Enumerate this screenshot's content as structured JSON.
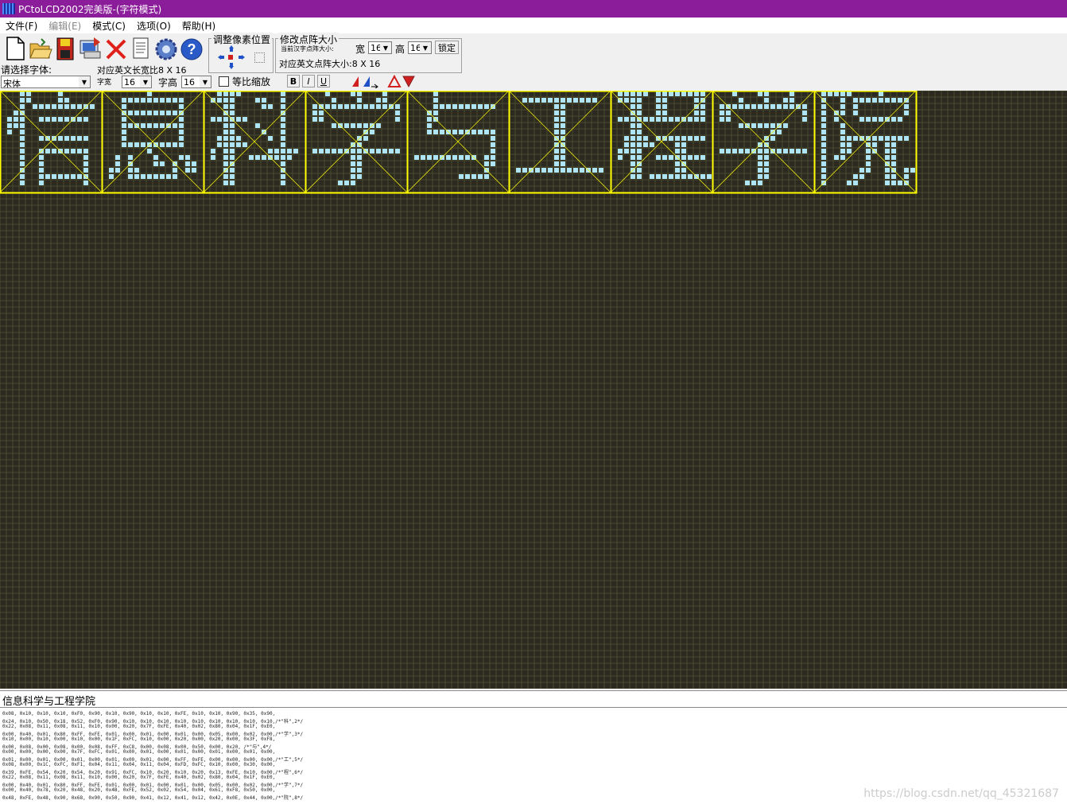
{
  "window": {
    "title": "PCtoLCD2002完美版-(字符模式)"
  },
  "menu": {
    "items": [
      {
        "label": "文件(F)",
        "enabled": true
      },
      {
        "label": "编辑(E)",
        "enabled": false
      },
      {
        "label": "模式(C)",
        "enabled": true
      },
      {
        "label": "选项(O)",
        "enabled": true
      },
      {
        "label": "帮助(H)",
        "enabled": true
      }
    ]
  },
  "toolbar": {
    "icons": [
      "new-file-icon",
      "open-folder-icon",
      "save-disk-icon",
      "generate-code-icon",
      "delete-x-icon",
      "document-icon",
      "settings-gear-icon",
      "help-icon"
    ],
    "font_label": "请选择字体:",
    "font_value": "宋体",
    "ratio_label": "对应英文长宽比8 X 16",
    "width_label": "字宽",
    "width_value": "16",
    "height_label": "字高",
    "height_value": "16",
    "proportional_label": "等比缩放",
    "bold": "B",
    "italic": "I",
    "underline": "U",
    "pixel_group_title": "调整像素位置",
    "matrix_group_title": "修改点阵大小",
    "current_size_label": "当前汉字点阵大小:",
    "matrix_width_label": "宽",
    "matrix_width_value": "16",
    "matrix_height_label": "高",
    "matrix_height_value": "16",
    "lock_label": "锁定",
    "english_size_label": "对应英文点阵大小:8 X 16"
  },
  "canvas": {
    "bg_color": "#2c2a20",
    "grid_color": "#4a4a2e",
    "pixel_on_color": "#aee4f6",
    "border_color": "#ffff00",
    "characters": [
      "信",
      "息",
      "科",
      "学",
      "与",
      "工",
      "程",
      "学",
      "院"
    ]
  },
  "input_text": "信息科学与工程学院",
  "output_lines": [
    "0x08, 0x10, 0x10, 0x10, 0xF0, 0x90, 0x10, 0x90, 0x10, 0x10, 0xFE, 0x10, 0x10, 0x90, 0x35, 0x90,",
    "0x24, 0x10, 0x50, 0x18, 0x52, 0xF0, 0x90, 0x10, 0x10, 0x10, 0x10, 0x10, 0x10, 0x10, 0x10, 0x10,/*\"科\",2*/",
    "0x22, 0x08, 0x11, 0x08, 0x11, 0x10, 0x00, 0x20, 0x7F, 0xFE, 0x40, 0x02, 0x80, 0x04, 0x1F, 0xE0,",
    "0x00, 0x40, 0x01, 0x80, 0xFF, 0xFE, 0x01, 0x00, 0x01, 0x00, 0x01, 0x00, 0x05, 0x00, 0x02, 0x00,/*\"学\",3*/",
    "0x10, 0x00, 0x10, 0x00, 0x10, 0x00, 0x1F, 0xFC, 0x10, 0x00, 0x20, 0x00, 0x20, 0x00, 0x3F, 0xF8,",
    "0x00, 0x08, 0x00, 0x08, 0x00, 0x08, 0xFF, 0xC8, 0x00, 0x08, 0x00, 0x50, 0x00, 0x20, /*\"与\",4*/",
    "0x00, 0x00, 0x00, 0x00, 0x7F, 0xFC, 0x01, 0x00, 0x01, 0x00, 0x01, 0x00, 0x01, 0x00, 0x01, 0x00,",
    "0x01, 0x00, 0x01, 0x00, 0x01, 0x00, 0x01, 0x00, 0x01, 0x00, 0xFF, 0xFE, 0x00, 0x00, 0x00, 0x00,/*\"工\",5*/",
    "0x08, 0x00, 0x1C, 0xFC, 0xF1, 0x04, 0x11, 0x04, 0x11, 0x04, 0xFD, 0xFC, 0x10, 0x00, 0x30, 0x00,",
    "0x39, 0xFE, 0x54, 0x20, 0x54, 0x20, 0x91, 0xFC, 0x10, 0x20, 0x10, 0x20, 0x13, 0xFE, 0x10, 0x00,/*\"程\",6*/",
    "0x22, 0x08, 0x11, 0x08, 0x11, 0x10, 0x00, 0x20, 0x7F, 0xFE, 0x40, 0x02, 0x80, 0x04, 0x1F, 0xE0,",
    "0x00, 0x40, 0x01, 0x80, 0xFF, 0xFE, 0x01, 0x00, 0x01, 0x00, 0x01, 0x00, 0x05, 0x00, 0x02, 0x00,/*\"学\",7*/",
    "0x00, 0x40, 0x78, 0x20, 0x48, 0x20, 0x4B, 0xFE, 0x52, 0x02, 0x54, 0x04, 0x61, 0xF8, 0x50, 0x00,",
    "0x48, 0xFE, 0x48, 0x90, 0x68, 0x90, 0x50, 0x90, 0x41, 0x12, 0x41, 0x12, 0x42, 0x0E, 0x44, 0x00,/*\"院\",8*/"
  ],
  "watermark": "https://blog.csdn.net/qq_45321687"
}
